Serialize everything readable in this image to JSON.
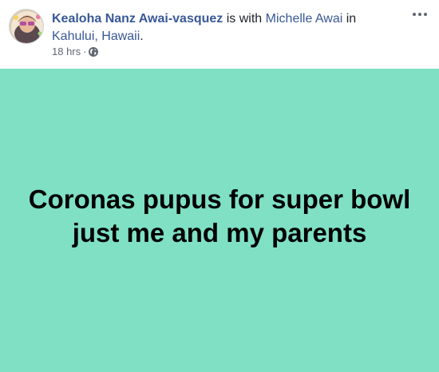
{
  "post": {
    "author": "Kealoha Nanz Awai-vasquez",
    "with_text": "is with",
    "tagged_person": "Michelle Awai",
    "in_text": "in",
    "location": "Kahului, Hawaii",
    "period": ".",
    "timestamp": "18 hrs",
    "separator": "·",
    "privacy_icon": "globe-icon",
    "more_icon": "more-options-icon",
    "body_line_1": "Coronas pupus for super bowl",
    "body_line_2": "just me and my parents",
    "background_color": "#7fe0c4"
  }
}
